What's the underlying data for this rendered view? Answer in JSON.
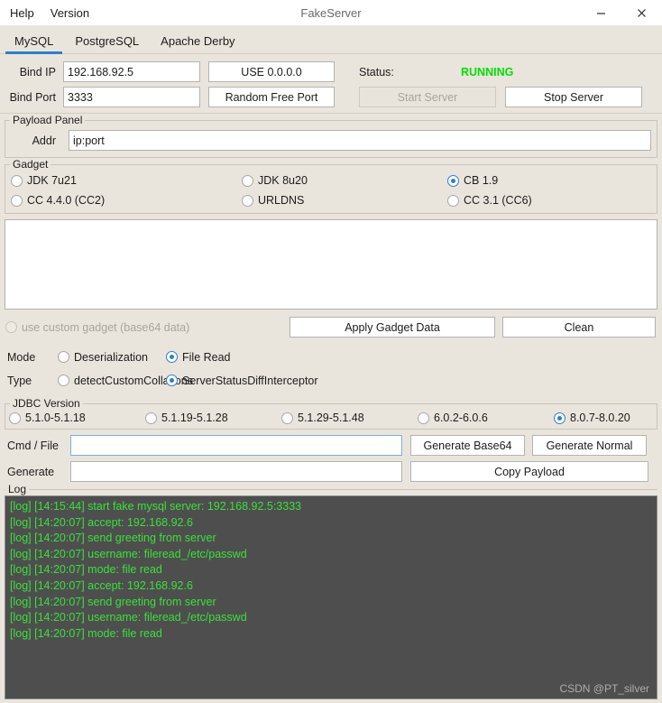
{
  "window": {
    "title": "FakeServer",
    "menu": [
      "Help",
      "Version"
    ],
    "controls": {
      "minimize": "–",
      "close": "✕"
    }
  },
  "tabs": [
    {
      "label": "MySQL",
      "active": true
    },
    {
      "label": "PostgreSQL",
      "active": false
    },
    {
      "label": "Apache Derby",
      "active": false
    }
  ],
  "server": {
    "bind_ip_label": "Bind IP",
    "bind_ip_value": "192.168.92.5",
    "use_any_button": "USE 0.0.0.0",
    "bind_port_label": "Bind Port",
    "bind_port_value": "3333",
    "random_port_button": "Random Free Port",
    "status_label": "Status:",
    "status_value": "RUNNING",
    "status_color": "#00e000",
    "start_button": "Start Server",
    "start_disabled": true,
    "stop_button": "Stop Server"
  },
  "payload_panel": {
    "title": "Payload Panel",
    "addr_label": "Addr",
    "addr_value": "ip:port",
    "addr_placeholder": "ip:port"
  },
  "gadget": {
    "title": "Gadget",
    "options": [
      {
        "label": "JDK 7u21",
        "selected": false
      },
      {
        "label": "JDK 8u20",
        "selected": false
      },
      {
        "label": "CB 1.9",
        "selected": true
      },
      {
        "label": "CC 4.4.0 (CC2)",
        "selected": false
      },
      {
        "label": "URLDNS",
        "selected": false
      },
      {
        "label": "CC 3.1 (CC6)",
        "selected": false
      }
    ],
    "custom_data": "",
    "custom_checkbox_label": "use custom gadget (base64 data)",
    "custom_checkbox_selected": false,
    "custom_checkbox_disabled": true,
    "apply_button": "Apply Gadget Data",
    "clean_button": "Clean"
  },
  "mode": {
    "label": "Mode",
    "options": [
      {
        "label": "Deserialization",
        "selected": false
      },
      {
        "label": "File Read",
        "selected": true
      }
    ]
  },
  "type": {
    "label": "Type",
    "options": [
      {
        "label": "detectCustomCollations",
        "selected": false
      },
      {
        "label": "ServerStatusDiffInterceptor",
        "selected": true
      }
    ]
  },
  "jdbc": {
    "title": "JDBC Version",
    "options": [
      {
        "label": "5.1.0-5.1.18",
        "selected": false
      },
      {
        "label": "5.1.19-5.1.28",
        "selected": false
      },
      {
        "label": "5.1.29-5.1.48",
        "selected": false
      },
      {
        "label": "6.0.2-6.0.6",
        "selected": false
      },
      {
        "label": "8.0.7-8.0.20",
        "selected": true
      }
    ]
  },
  "command": {
    "cmd_label": "Cmd / File",
    "cmd_value": "",
    "cmd_focused": true,
    "generate_base64_button": "Generate Base64",
    "generate_normal_button": "Generate Normal",
    "generate_label": "Generate",
    "generate_value": "",
    "copy_payload_button": "Copy Payload"
  },
  "log": {
    "title": "Log",
    "lines": [
      "[log] [14:15:44] start fake mysql server: 192.168.92.5:3333",
      "[log] [14:20:07] accept: 192.168.92.6",
      "[log] [14:20:07] send greeting from server",
      "[log] [14:20:07] username: fileread_/etc/passwd",
      "[log] [14:20:07] mode: file read",
      "[log] [14:20:07] accept: 192.168.92.6",
      "[log] [14:20:07] send greeting from server",
      "[log] [14:20:07] username: fileread_/etc/passwd",
      "[log] [14:20:07] mode: file read"
    ],
    "watermark": "CSDN @PT_silver"
  }
}
